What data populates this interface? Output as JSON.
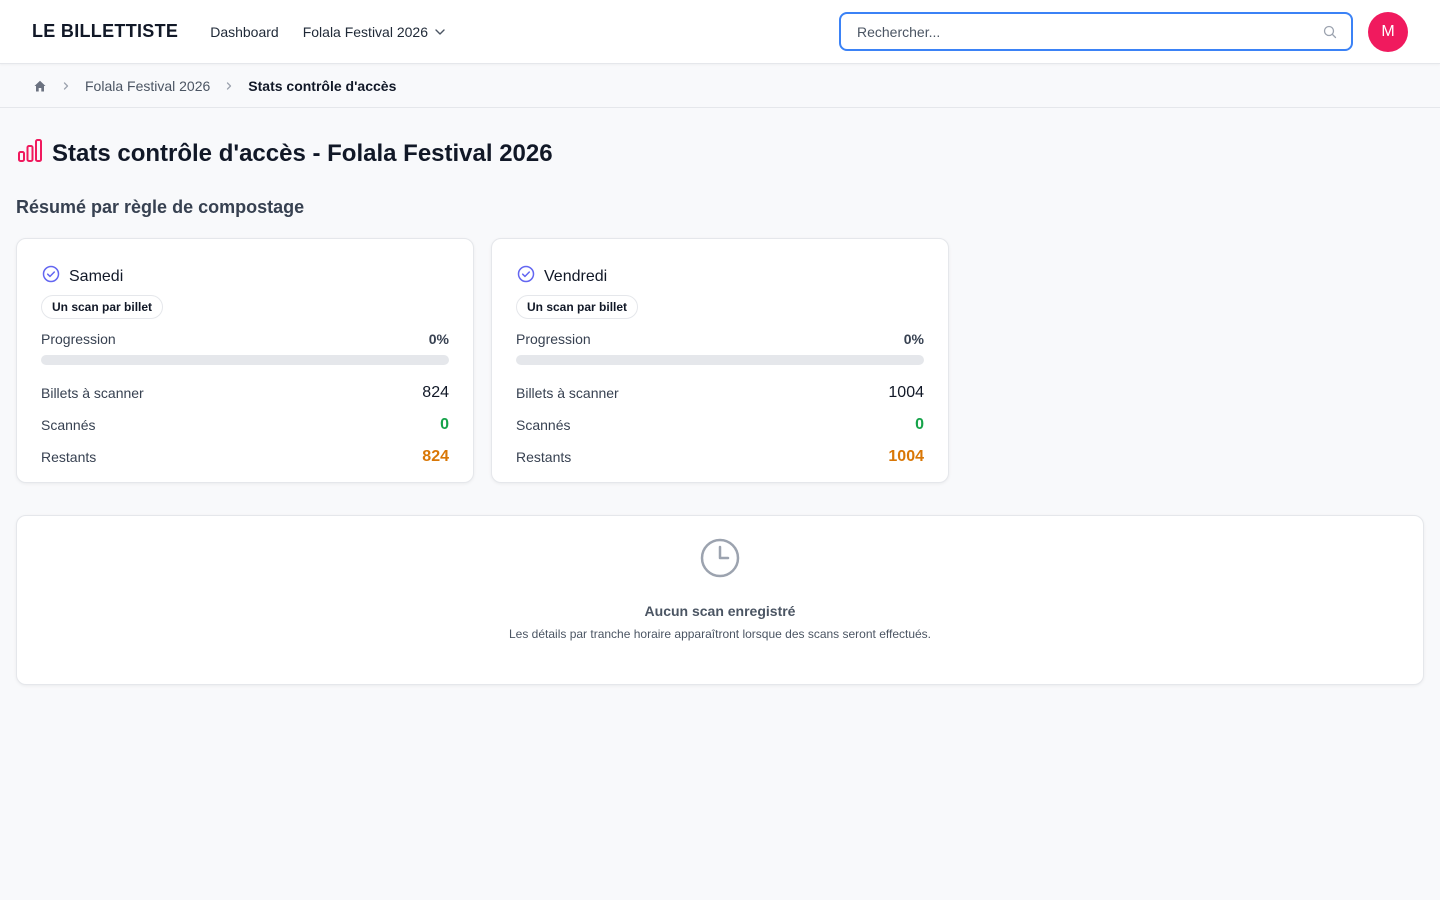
{
  "header": {
    "logo": "LE BILLETTISTE",
    "nav": [
      {
        "label": "Dashboard"
      },
      {
        "label": "Folala Festival 2026",
        "has_dropdown": true
      }
    ],
    "search": {
      "placeholder": "Rechercher...",
      "value": ""
    },
    "avatar_initial": "M"
  },
  "breadcrumb": {
    "items": [
      "Folala Festival 2026",
      "Stats contrôle d'accès"
    ]
  },
  "page": {
    "title": "Stats contrôle d'accès - Folala Festival 2026",
    "section_title": "Résumé par règle de compostage"
  },
  "cards": [
    {
      "name": "Samedi",
      "rule": "Un scan par billet",
      "progress_label": "Progression",
      "progress_pct": "0%",
      "progress_value": 0,
      "rows": [
        {
          "label": "Billets à scanner",
          "value": "824"
        },
        {
          "label": "Scannés",
          "value": "0"
        },
        {
          "label": "Restants",
          "value": "824"
        }
      ]
    },
    {
      "name": "Vendredi",
      "rule": "Un scan par billet",
      "progress_label": "Progression",
      "progress_pct": "0%",
      "progress_value": 0,
      "rows": [
        {
          "label": "Billets à scanner",
          "value": "1004"
        },
        {
          "label": "Scannés",
          "value": "0"
        },
        {
          "label": "Restants",
          "value": "1004"
        }
      ]
    }
  ],
  "empty_state": {
    "title": "Aucun scan enregistré",
    "description": "Les détails par tranche horaire apparaîtront lorsque des scans seront effectués."
  },
  "colors": {
    "accent": "#f01a5e",
    "focus": "#3b82f6",
    "scanned": "#16a34a",
    "remaining": "#d97706",
    "check_icon": "#6366f1"
  },
  "icons": {
    "title": "bar-chart-icon",
    "card": "check-circle-icon",
    "empty": "clock-icon",
    "home": "home-icon",
    "search": "search-icon"
  }
}
